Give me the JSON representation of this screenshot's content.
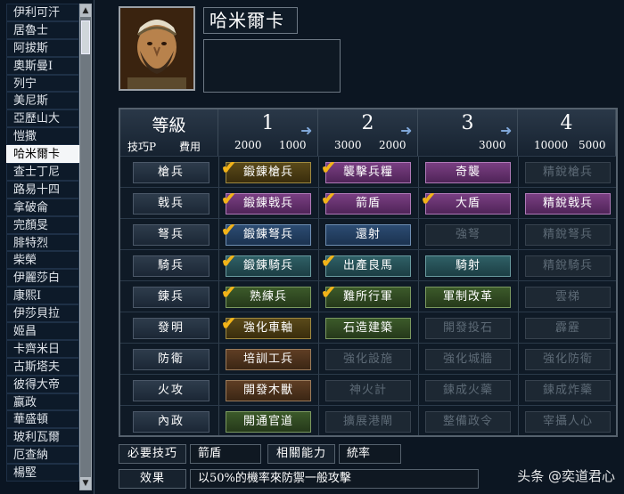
{
  "sidebar": {
    "items": [
      {
        "label": "伊利可汗",
        "selected": false
      },
      {
        "label": "居魯士",
        "selected": false
      },
      {
        "label": "阿拔斯",
        "selected": false
      },
      {
        "label": "奧斯曼Ⅰ",
        "selected": false
      },
      {
        "label": "列宁",
        "selected": false
      },
      {
        "label": "美尼斯",
        "selected": false
      },
      {
        "label": "亞歷山大",
        "selected": false
      },
      {
        "label": "愷撒",
        "selected": false
      },
      {
        "label": "哈米爾卡",
        "selected": true
      },
      {
        "label": "查士丁尼",
        "selected": false
      },
      {
        "label": "路易十四",
        "selected": false
      },
      {
        "label": "拿破侖",
        "selected": false
      },
      {
        "label": "完顏旻",
        "selected": false
      },
      {
        "label": "腓特烈",
        "selected": false
      },
      {
        "label": "柴榮",
        "selected": false
      },
      {
        "label": "伊麗莎白",
        "selected": false
      },
      {
        "label": "康熙Ⅰ",
        "selected": false
      },
      {
        "label": "伊莎貝拉",
        "selected": false
      },
      {
        "label": "姬昌",
        "selected": false
      },
      {
        "label": "卡齊米日",
        "selected": false
      },
      {
        "label": "古斯塔夫",
        "selected": false
      },
      {
        "label": "彼得大帝",
        "selected": false
      },
      {
        "label": "嬴政",
        "selected": false
      },
      {
        "label": "華盛頓",
        "selected": false
      },
      {
        "label": "玻利瓦爾",
        "selected": false
      },
      {
        "label": "厄查納",
        "selected": false
      },
      {
        "label": "楊堅",
        "selected": false
      }
    ]
  },
  "character": {
    "name": "哈米爾卡"
  },
  "grid": {
    "header_title": "等級",
    "header_sub_left": "技巧P",
    "header_sub_right": "費用",
    "levels": [
      {
        "num": "1",
        "p": "2000",
        "cost": "1000"
      },
      {
        "num": "2",
        "p": "3000",
        "cost": "2000"
      },
      {
        "num": "3",
        "p": "",
        "cost": "3000"
      },
      {
        "num": "4",
        "p": "10000",
        "cost": "5000"
      }
    ],
    "rows": [
      {
        "label": "槍兵",
        "cells": [
          {
            "text": "鍛錬槍兵",
            "style": "gold",
            "check": true
          },
          {
            "text": "襲擊兵糧",
            "style": "purple",
            "check": true
          },
          {
            "text": "奇襲",
            "style": "purple",
            "check": false
          },
          {
            "text": "精銳槍兵",
            "style": "dim",
            "check": false
          }
        ]
      },
      {
        "label": "戟兵",
        "cells": [
          {
            "text": "鍛錬戟兵",
            "style": "purple",
            "check": true
          },
          {
            "text": "箭盾",
            "style": "purple",
            "check": true
          },
          {
            "text": "大盾",
            "style": "purple",
            "check": true
          },
          {
            "text": "精銳戟兵",
            "style": "purple",
            "check": false
          }
        ]
      },
      {
        "label": "弩兵",
        "cells": [
          {
            "text": "鍛錬弩兵",
            "style": "blue",
            "check": true
          },
          {
            "text": "還射",
            "style": "blue",
            "check": false
          },
          {
            "text": "強弩",
            "style": "dim",
            "check": false
          },
          {
            "text": "精銳弩兵",
            "style": "dim",
            "check": false
          }
        ]
      },
      {
        "label": "騎兵",
        "cells": [
          {
            "text": "鍛錬騎兵",
            "style": "teal",
            "check": true
          },
          {
            "text": "出產良馬",
            "style": "teal",
            "check": true
          },
          {
            "text": "騎射",
            "style": "teal",
            "check": false
          },
          {
            "text": "精銳騎兵",
            "style": "dim",
            "check": false
          }
        ]
      },
      {
        "label": "錬兵",
        "cells": [
          {
            "text": "熟練兵",
            "style": "green",
            "check": true
          },
          {
            "text": "難所行軍",
            "style": "green",
            "check": true
          },
          {
            "text": "軍制改革",
            "style": "green",
            "check": false
          },
          {
            "text": "雲梯",
            "style": "dim",
            "check": false
          }
        ]
      },
      {
        "label": "發明",
        "cells": [
          {
            "text": "強化車軸",
            "style": "gold",
            "check": true
          },
          {
            "text": "石造建築",
            "style": "green",
            "check": false
          },
          {
            "text": "開發投石",
            "style": "dim",
            "check": false
          },
          {
            "text": "霹靂",
            "style": "dim",
            "check": false
          }
        ]
      },
      {
        "label": "防衛",
        "cells": [
          {
            "text": "培訓工兵",
            "style": "brown",
            "check": false
          },
          {
            "text": "強化設施",
            "style": "dim",
            "check": false
          },
          {
            "text": "強化城牆",
            "style": "dim",
            "check": false
          },
          {
            "text": "強化防衛",
            "style": "dim",
            "check": false
          }
        ]
      },
      {
        "label": "火攻",
        "cells": [
          {
            "text": "開發木獸",
            "style": "brown",
            "check": false
          },
          {
            "text": "神火計",
            "style": "dim",
            "check": false
          },
          {
            "text": "鍊成火藥",
            "style": "dim",
            "check": false
          },
          {
            "text": "鍊成炸藥",
            "style": "dim",
            "check": false
          }
        ]
      },
      {
        "label": "內政",
        "cells": [
          {
            "text": "開通官道",
            "style": "green",
            "check": false
          },
          {
            "text": "擴展港閘",
            "style": "dim",
            "check": false
          },
          {
            "text": "整備政令",
            "style": "dim",
            "check": false
          },
          {
            "text": "宰攝人心",
            "style": "dim",
            "check": false
          }
        ]
      }
    ]
  },
  "bottom": {
    "required_label": "必要技巧",
    "required_value": "箭盾",
    "related_label": "相關能力",
    "related_value": "統率",
    "effect_label": "效果",
    "effect_value": "以50%的機率來防禦一般攻擊"
  },
  "watermark": {
    "text": "头条 @奕道君心"
  },
  "icons": {
    "check": "check-mark-icon",
    "arrow": "arrow-right-icon"
  }
}
